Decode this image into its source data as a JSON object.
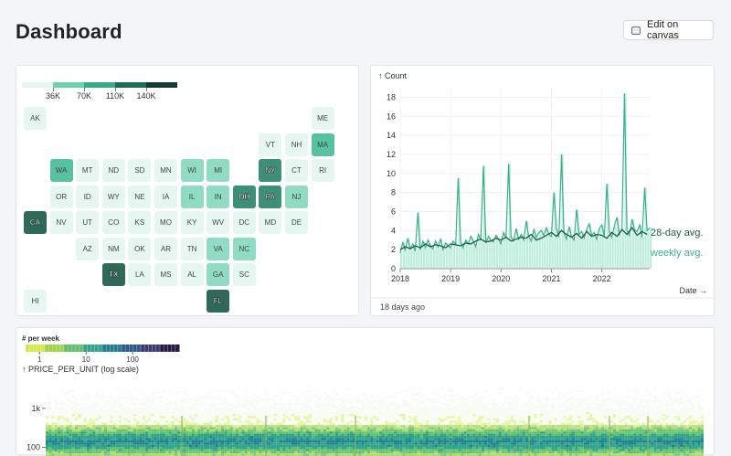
{
  "header": {
    "title": "Dashboard",
    "edit_label": "Edit on canvas"
  },
  "map": {
    "legend": {
      "ticks": [
        "36K",
        "70K",
        "110K",
        "140K"
      ],
      "colors": [
        "#e3f7f0",
        "#6fd0b0",
        "#3aa88a",
        "#1f6d58",
        "#0f3d31"
      ]
    },
    "tiles": [
      {
        "abbr": "AK",
        "col": 0,
        "row": 0,
        "level": 0
      },
      {
        "abbr": "ME",
        "col": 11,
        "row": 0,
        "level": 0
      },
      {
        "abbr": "VT",
        "col": 9,
        "row": 1,
        "level": 0
      },
      {
        "abbr": "NH",
        "col": 10,
        "row": 1,
        "level": 0
      },
      {
        "abbr": "MA",
        "col": 11,
        "row": 1,
        "level": 2
      },
      {
        "abbr": "WA",
        "col": 1,
        "row": 2,
        "level": 2
      },
      {
        "abbr": "MT",
        "col": 2,
        "row": 2,
        "level": 0
      },
      {
        "abbr": "ND",
        "col": 3,
        "row": 2,
        "level": 0
      },
      {
        "abbr": "SD",
        "col": 4,
        "row": 2,
        "level": 0
      },
      {
        "abbr": "MN",
        "col": 5,
        "row": 2,
        "level": 0
      },
      {
        "abbr": "WI",
        "col": 6,
        "row": 2,
        "level": 1
      },
      {
        "abbr": "MI",
        "col": 7,
        "row": 2,
        "level": 1
      },
      {
        "abbr": "NY",
        "col": 9,
        "row": 2,
        "level": 3
      },
      {
        "abbr": "CT",
        "col": 10,
        "row": 2,
        "level": 0
      },
      {
        "abbr": "RI",
        "col": 11,
        "row": 2,
        "level": 0
      },
      {
        "abbr": "OR",
        "col": 1,
        "row": 3,
        "level": 0
      },
      {
        "abbr": "ID",
        "col": 2,
        "row": 3,
        "level": 0
      },
      {
        "abbr": "WY",
        "col": 3,
        "row": 3,
        "level": 0
      },
      {
        "abbr": "NE",
        "col": 4,
        "row": 3,
        "level": 0
      },
      {
        "abbr": "IA",
        "col": 5,
        "row": 3,
        "level": 0
      },
      {
        "abbr": "IL",
        "col": 6,
        "row": 3,
        "level": 1
      },
      {
        "abbr": "IN",
        "col": 7,
        "row": 3,
        "level": 1
      },
      {
        "abbr": "OH",
        "col": 8,
        "row": 3,
        "level": 3
      },
      {
        "abbr": "PA",
        "col": 9,
        "row": 3,
        "level": 3
      },
      {
        "abbr": "NJ",
        "col": 10,
        "row": 3,
        "level": 1
      },
      {
        "abbr": "CA",
        "col": 0,
        "row": 4,
        "level": 4
      },
      {
        "abbr": "NV",
        "col": 1,
        "row": 4,
        "level": 0
      },
      {
        "abbr": "UT",
        "col": 2,
        "row": 4,
        "level": 0
      },
      {
        "abbr": "CO",
        "col": 3,
        "row": 4,
        "level": 0
      },
      {
        "abbr": "KS",
        "col": 4,
        "row": 4,
        "level": 0
      },
      {
        "abbr": "MO",
        "col": 5,
        "row": 4,
        "level": 0
      },
      {
        "abbr": "KY",
        "col": 6,
        "row": 4,
        "level": 0
      },
      {
        "abbr": "WV",
        "col": 7,
        "row": 4,
        "level": 0
      },
      {
        "abbr": "DC",
        "col": 8,
        "row": 4,
        "level": 0
      },
      {
        "abbr": "MD",
        "col": 9,
        "row": 4,
        "level": 0
      },
      {
        "abbr": "DE",
        "col": 10,
        "row": 4,
        "level": 0
      },
      {
        "abbr": "AZ",
        "col": 2,
        "row": 5,
        "level": 0
      },
      {
        "abbr": "NM",
        "col": 3,
        "row": 5,
        "level": 0
      },
      {
        "abbr": "OK",
        "col": 4,
        "row": 5,
        "level": 0
      },
      {
        "abbr": "AR",
        "col": 5,
        "row": 5,
        "level": 0
      },
      {
        "abbr": "TN",
        "col": 6,
        "row": 5,
        "level": 0
      },
      {
        "abbr": "VA",
        "col": 7,
        "row": 5,
        "level": 1
      },
      {
        "abbr": "NC",
        "col": 8,
        "row": 5,
        "level": 1
      },
      {
        "abbr": "TX",
        "col": 3,
        "row": 6,
        "level": 4
      },
      {
        "abbr": "LA",
        "col": 4,
        "row": 6,
        "level": 0
      },
      {
        "abbr": "MS",
        "col": 5,
        "row": 6,
        "level": 0
      },
      {
        "abbr": "AL",
        "col": 6,
        "row": 6,
        "level": 0
      },
      {
        "abbr": "GA",
        "col": 7,
        "row": 6,
        "level": 1
      },
      {
        "abbr": "SC",
        "col": 8,
        "row": 6,
        "level": 0
      },
      {
        "abbr": "HI",
        "col": 0,
        "row": 7,
        "level": 0
      },
      {
        "abbr": "FL",
        "col": 7,
        "row": 7,
        "level": 4
      }
    ],
    "level_colors": [
      "#e6f7f1",
      "#8fdcc3",
      "#56c2a0",
      "#3e8f78",
      "#2f6a59"
    ]
  },
  "line_chart": {
    "footer": "18 days ago",
    "chart_data": {
      "type": "line",
      "ylabel": "↑ Count",
      "xlabel": "Date →",
      "ylim": [
        0,
        19
      ],
      "y_ticks": [
        0,
        2,
        4,
        6,
        8,
        10,
        12,
        14,
        16,
        18
      ],
      "x_ticks": [
        "2018",
        "2019",
        "2020",
        "2021",
        "2022"
      ],
      "x_tick_values": [
        2018,
        2019,
        2020,
        2021,
        2022
      ],
      "xlim": [
        2018,
        2022.95
      ],
      "series": [
        {
          "name": "28-day avg.",
          "color": "#1f5a4a",
          "x": [
            2018.0,
            2018.1,
            2018.2,
            2018.3,
            2018.4,
            2018.5,
            2018.6,
            2018.7,
            2018.8,
            2018.9,
            2019.0,
            2019.1,
            2019.2,
            2019.3,
            2019.4,
            2019.5,
            2019.6,
            2019.7,
            2019.8,
            2019.9,
            2020.0,
            2020.1,
            2020.2,
            2020.3,
            2020.4,
            2020.5,
            2020.6,
            2020.7,
            2020.8,
            2020.9,
            2021.0,
            2021.1,
            2021.2,
            2021.3,
            2021.4,
            2021.5,
            2021.6,
            2021.7,
            2021.8,
            2021.9,
            2022.0,
            2022.1,
            2022.2,
            2022.3,
            2022.4,
            2022.5,
            2022.6,
            2022.7,
            2022.8,
            2022.9
          ],
          "values": [
            2.0,
            2.3,
            2.1,
            2.4,
            2.2,
            2.6,
            2.3,
            2.5,
            2.4,
            2.2,
            2.6,
            2.5,
            2.4,
            2.7,
            2.6,
            2.9,
            3.1,
            2.8,
            2.9,
            3.2,
            3.0,
            3.3,
            2.9,
            3.1,
            3.3,
            3.2,
            3.6,
            3.0,
            3.2,
            3.5,
            3.8,
            3.4,
            4.0,
            3.6,
            3.3,
            3.7,
            3.2,
            3.9,
            3.4,
            3.6,
            3.5,
            3.2,
            3.8,
            3.4,
            4.1,
            3.6,
            4.3,
            3.5,
            3.9,
            3.6
          ]
        },
        {
          "name": "weekly avg.",
          "color": "#3ab08a",
          "x": [
            2018.0,
            2018.05,
            2018.1,
            2018.15,
            2018.2,
            2018.25,
            2018.3,
            2018.35,
            2018.4,
            2018.45,
            2018.5,
            2018.55,
            2018.6,
            2018.65,
            2018.7,
            2018.75,
            2018.8,
            2018.85,
            2018.9,
            2018.95,
            2019.0,
            2019.05,
            2019.1,
            2019.15,
            2019.2,
            2019.25,
            2019.3,
            2019.35,
            2019.4,
            2019.45,
            2019.5,
            2019.55,
            2019.6,
            2019.65,
            2019.7,
            2019.75,
            2019.8,
            2019.85,
            2019.9,
            2019.95,
            2020.0,
            2020.05,
            2020.1,
            2020.15,
            2020.2,
            2020.25,
            2020.3,
            2020.35,
            2020.4,
            2020.45,
            2020.5,
            2020.55,
            2020.6,
            2020.65,
            2020.7,
            2020.75,
            2020.8,
            2020.85,
            2020.9,
            2020.95,
            2021.0,
            2021.05,
            2021.1,
            2021.15,
            2021.2,
            2021.25,
            2021.3,
            2021.35,
            2021.4,
            2021.45,
            2021.5,
            2021.55,
            2021.6,
            2021.65,
            2021.7,
            2021.75,
            2021.8,
            2021.85,
            2021.9,
            2021.95,
            2022.0,
            2022.05,
            2022.1,
            2022.15,
            2022.2,
            2022.25,
            2022.3,
            2022.35,
            2022.4,
            2022.45,
            2022.5,
            2022.55,
            2022.6,
            2022.65,
            2022.7,
            2022.75,
            2022.8,
            2022.85,
            2022.9,
            2022.95
          ],
          "values": [
            1.6,
            2.8,
            1.9,
            3.2,
            2.1,
            2.6,
            1.8,
            5.9,
            2.0,
            2.9,
            2.2,
            3.0,
            2.4,
            2.1,
            2.9,
            2.3,
            3.1,
            2.0,
            2.7,
            2.4,
            2.2,
            2.9,
            2.5,
            9.5,
            2.8,
            2.2,
            3.0,
            2.6,
            3.4,
            2.9,
            2.3,
            3.6,
            3.0,
            10.8,
            2.7,
            3.4,
            3.0,
            2.8,
            3.5,
            3.1,
            2.6,
            3.8,
            3.2,
            11.0,
            3.3,
            2.9,
            4.2,
            3.1,
            3.6,
            3.0,
            5.0,
            3.4,
            2.9,
            4.1,
            3.3,
            3.8,
            4.0,
            3.5,
            4.3,
            3.6,
            3.4,
            8.0,
            4.2,
            3.3,
            12.0,
            3.7,
            3.1,
            4.4,
            3.4,
            3.0,
            6.2,
            3.6,
            3.9,
            3.2,
            4.1,
            4.7,
            3.5,
            3.8,
            3.1,
            4.2,
            4.6,
            3.4,
            8.9,
            3.9,
            3.3,
            4.5,
            5.4,
            3.6,
            4.2,
            18.4,
            4.0,
            3.5,
            5.2,
            4.1,
            3.9,
            4.6,
            3.3,
            8.5,
            4.0,
            4.3
          ]
        }
      ]
    }
  },
  "heatmap": {
    "legend_title": "# per week",
    "legend_ticks": [
      "1",
      "10",
      "100"
    ],
    "legend_tick_values": [
      1,
      10,
      100
    ],
    "legend_range": [
      0.5,
      1000
    ],
    "legend_colors": [
      "#d4e84a",
      "#9fd44a",
      "#5fbf6a",
      "#2fa48a",
      "#1f7f90",
      "#2a5a8a",
      "#3a3a7a",
      "#2a1a4a"
    ],
    "chart_data": {
      "type": "heatmap",
      "ylabel": "↑ PRICE_PER_UNIT (log scale)",
      "y_scale": "log",
      "y_ticks": [
        "1k",
        "100"
      ],
      "y_tick_values": [
        1000,
        100
      ],
      "ylim": [
        60,
        5000
      ],
      "density_band": {
        "center": 150,
        "lower": 80,
        "upper": 400
      }
    }
  }
}
